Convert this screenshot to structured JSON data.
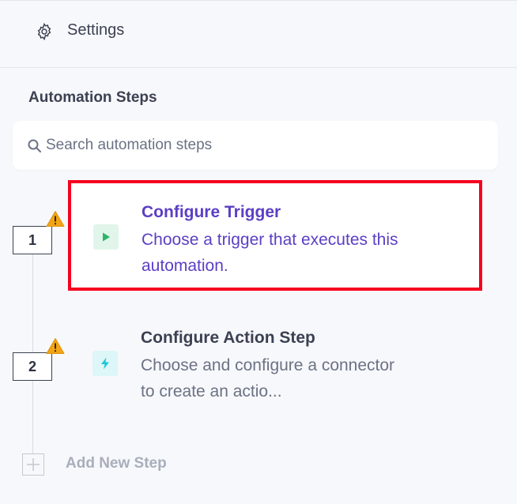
{
  "settings": {
    "label": "Settings",
    "icon": "gear-icon"
  },
  "section": {
    "title": "Automation Steps"
  },
  "search": {
    "placeholder": "Search automation steps",
    "value": ""
  },
  "steps": [
    {
      "number": "1",
      "title": "Configure Trigger",
      "description": "Choose a trigger that executes this automation.",
      "icon": "play-icon",
      "warning": true,
      "highlighted": true
    },
    {
      "number": "2",
      "title": "Configure Action Step",
      "description": "Choose and configure a connector to create an actio...",
      "icon": "bolt-icon",
      "warning": true,
      "highlighted": false
    }
  ],
  "add_step": {
    "label": "Add New Step"
  },
  "colors": {
    "accent": "#5b3fc4",
    "text": "#3b4152",
    "muted_text": "#6b7284",
    "highlight_border": "#f5001f",
    "warning": "#f2a417",
    "trigger_icon": "#2fb36c",
    "action_icon": "#1ec6d8",
    "disabled": "#a8aebb"
  }
}
